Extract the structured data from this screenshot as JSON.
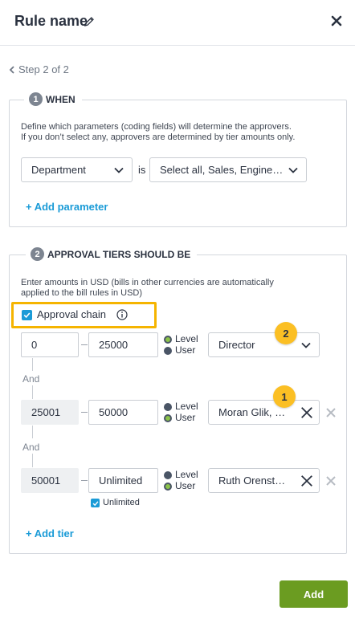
{
  "header": {
    "title": "Rule name",
    "edit_icon": "pencil-icon",
    "close_icon": "close-icon"
  },
  "step": {
    "label": "Step 2 of 2"
  },
  "when": {
    "number": "1",
    "title": "WHEN",
    "description_line1": "Define which parameters (coding fields) will determine the approvers.",
    "description_line2": "If you don’t select any, approvers are determined by tier amounts only.",
    "parameter_value": "Department",
    "operator": "is",
    "values_value": "Select all, Sales, Engine…",
    "add_parameter": "+ Add parameter"
  },
  "tiers": {
    "number": "2",
    "title": "APPROVAL TIERS SHOULD BE",
    "description_line1": "Enter amounts in USD (bills in other currencies are automatically",
    "description_line2": "applied to the bill rules in USD)",
    "approval_chain_label": "Approval chain",
    "approval_chain_checked": true,
    "and_label": "And",
    "level_label": "Level",
    "user_label": "User",
    "rows": [
      {
        "from": "0",
        "to": "25000",
        "selected": "level",
        "approver": "Director",
        "removable": false
      },
      {
        "from": "25001",
        "to": "50000",
        "selected": "user",
        "approver": "Moran Glik, …",
        "removable": true
      },
      {
        "from": "50001",
        "to": "Unlimited",
        "selected": "user",
        "approver": "Ruth Orenst…",
        "removable": true
      }
    ],
    "unlimited_label": "Unlimited",
    "unlimited_checked": true,
    "add_tier": "+ Add tier"
  },
  "callouts": {
    "badge_1": "1",
    "badge_2": "2",
    "highlight_color": "#f5b400",
    "badge_color": "#fbbf24"
  },
  "footer": {
    "add_button": "Add",
    "button_color": "#6b9c21"
  },
  "colors": {
    "link": "#1a9bd7",
    "text": "#2b3240"
  }
}
